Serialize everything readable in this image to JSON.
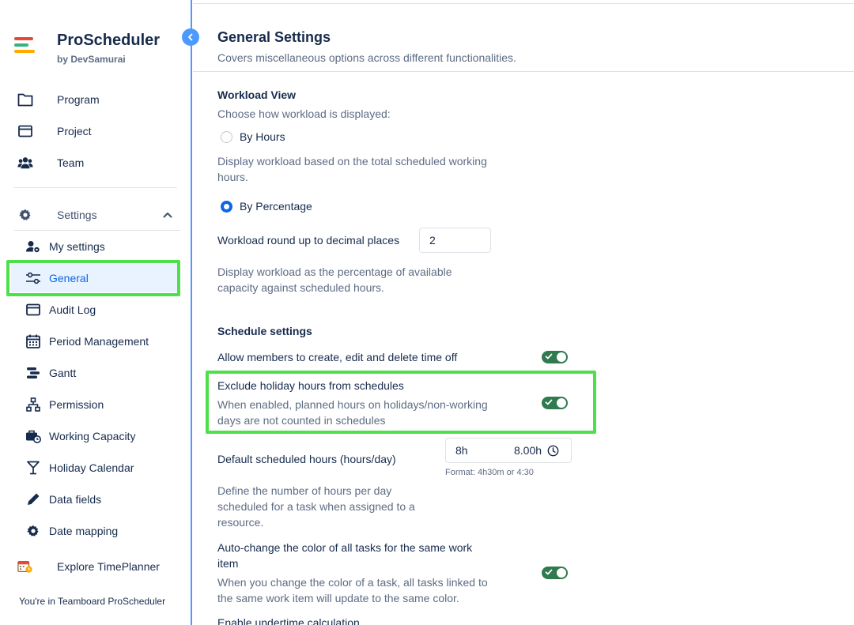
{
  "app": {
    "name": "ProScheduler",
    "by": "by DevSamurai"
  },
  "sidebar": {
    "main_items": [
      {
        "label": "Program",
        "icon": "folder-icon"
      },
      {
        "label": "Project",
        "icon": "window-icon"
      },
      {
        "label": "Team",
        "icon": "team-icon"
      }
    ],
    "settings_label": "Settings",
    "settings_items": [
      {
        "label": "My settings",
        "icon": "user-gear-icon"
      },
      {
        "label": "General",
        "icon": "sliders-icon"
      },
      {
        "label": "Audit Log",
        "icon": "window-icon"
      },
      {
        "label": "Period Management",
        "icon": "calendar-icon"
      },
      {
        "label": "Gantt",
        "icon": "gantt-icon"
      },
      {
        "label": "Permission",
        "icon": "hierarchy-icon"
      },
      {
        "label": "Working Capacity",
        "icon": "briefcase-clock-icon"
      },
      {
        "label": "Holiday Calendar",
        "icon": "cocktail-icon"
      },
      {
        "label": "Data fields",
        "icon": "pencil-icon"
      },
      {
        "label": "Date mapping",
        "icon": "gear-icon"
      }
    ],
    "explore_label": "Explore TimePlanner",
    "footer": "You're in Teamboard ProScheduler"
  },
  "page": {
    "title": "General Settings",
    "subtitle": "Covers miscellaneous options across different functionalities."
  },
  "workload": {
    "heading": "Workload View",
    "prompt": "Choose how workload is displayed:",
    "option_hours": "By Hours",
    "hours_desc_1": "Display workload based on the total scheduled working",
    "hours_desc_2": "hours.",
    "option_percentage": "By Percentage",
    "selected": "By Percentage",
    "round_label": "Workload round up to decimal places",
    "round_value": "2",
    "pct_desc_1": "Display workload as the percentage of available",
    "pct_desc_2": "capacity against scheduled hours."
  },
  "schedule": {
    "heading": "Schedule settings",
    "allow_timeoff": "Allow members to create, edit and delete time off",
    "allow_timeoff_on": true,
    "exclude_holiday": "Exclude holiday hours from schedules",
    "exclude_desc_1": "When enabled, planned hours on holidays/non-working",
    "exclude_desc_2": "days are not counted in schedules",
    "exclude_holiday_on": true,
    "default_hours_label": "Default scheduled hours (hours/day)",
    "default_hours_value": "8h",
    "default_hours_decimal": "8.00h",
    "format_hint": "Format: 4h30m or 4:30",
    "default_desc_1": "Define the number of hours per day",
    "default_desc_2": "scheduled for a task when assigned to a",
    "default_desc_3": "resource.",
    "auto_color_1": "Auto-change the color of all tasks for the same work",
    "auto_color_2": "item",
    "auto_color_desc_1": "When you change the color of a task, all tasks linked to",
    "auto_color_desc_2": "the same work item will update to the same color.",
    "auto_color_on": true,
    "undertime": "Enable undertime calculation"
  },
  "colors": {
    "accent": "#0c66e4",
    "sidebar_border": "#4c9aff",
    "toggle_on": "#2f7a4e",
    "highlight": "#4ee04a"
  }
}
